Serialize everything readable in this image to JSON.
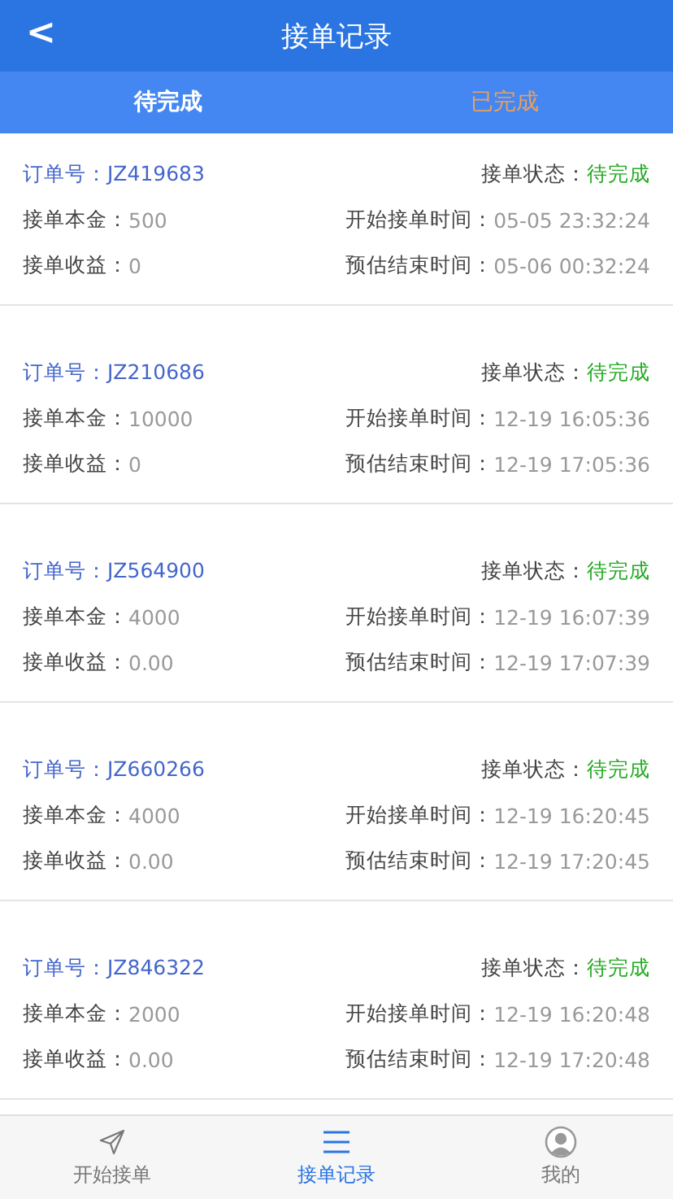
{
  "header": {
    "back": "<",
    "title": "接单记录"
  },
  "tabs": [
    {
      "label": "待完成",
      "selected": true
    },
    {
      "label": "已完成",
      "selected": false
    }
  ],
  "orders": [
    {
      "order_label": "订单号：",
      "order_no": "JZ419683",
      "status_label": "接单状态：",
      "status": "待完成",
      "principal_label": "接单本金：",
      "principal": "500",
      "start_label": "开始接单时间：",
      "start": "05-05 23:32:24",
      "earnings_label": "接单收益：",
      "earnings": "0",
      "end_label": "预估结束时间：",
      "end": "05-06 00:32:24"
    },
    {
      "order_label": "订单号：",
      "order_no": "JZ210686",
      "status_label": "接单状态：",
      "status": "待完成",
      "principal_label": "接单本金：",
      "principal": "10000",
      "start_label": "开始接单时间：",
      "start": "12-19 16:05:36",
      "earnings_label": "接单收益：",
      "earnings": "0",
      "end_label": "预估结束时间：",
      "end": "12-19 17:05:36"
    },
    {
      "order_label": "订单号：",
      "order_no": "JZ564900",
      "status_label": "接单状态：",
      "status": "待完成",
      "principal_label": "接单本金：",
      "principal": "4000",
      "start_label": "开始接单时间：",
      "start": "12-19 16:07:39",
      "earnings_label": "接单收益：",
      "earnings": "0.00",
      "end_label": "预估结束时间：",
      "end": "12-19 17:07:39"
    },
    {
      "order_label": "订单号：",
      "order_no": "JZ660266",
      "status_label": "接单状态：",
      "status": "待完成",
      "principal_label": "接单本金：",
      "principal": "4000",
      "start_label": "开始接单时间：",
      "start": "12-19 16:20:45",
      "earnings_label": "接单收益：",
      "earnings": "0.00",
      "end_label": "预估结束时间：",
      "end": "12-19 17:20:45"
    },
    {
      "order_label": "订单号：",
      "order_no": "JZ846322",
      "status_label": "接单状态：",
      "status": "待完成",
      "principal_label": "接单本金：",
      "principal": "2000",
      "start_label": "开始接单时间：",
      "start": "12-19 16:20:48",
      "earnings_label": "接单收益：",
      "earnings": "0.00",
      "end_label": "预估结束时间：",
      "end": "12-19 17:20:48"
    }
  ],
  "bottom_nav": [
    {
      "kind": "send",
      "label": "开始接单",
      "selected": false
    },
    {
      "kind": "list",
      "label": "接单记录",
      "selected": true
    },
    {
      "kind": "user",
      "label": "我的",
      "selected": false
    }
  ]
}
